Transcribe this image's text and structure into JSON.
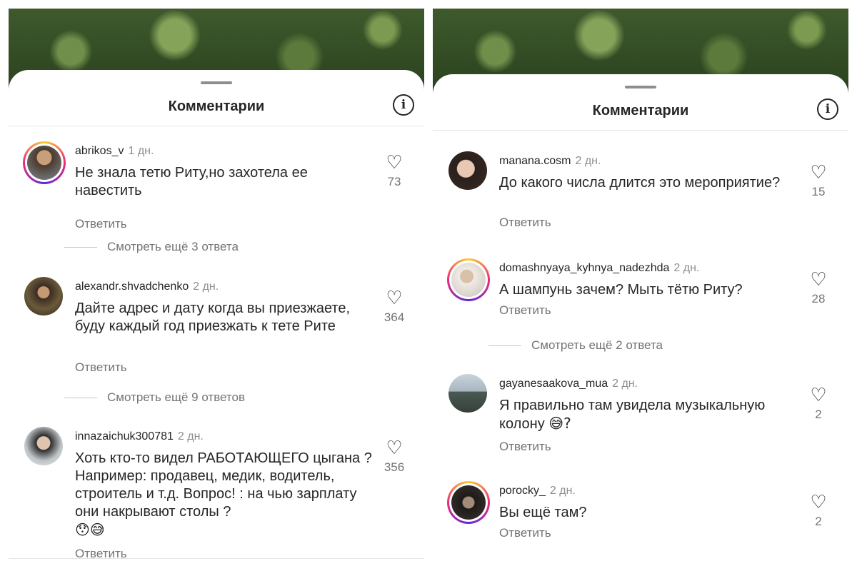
{
  "left_panel": {
    "title": "Комментарии",
    "comments": [
      {
        "username": "abrikos_v",
        "time": "1 дн.",
        "text": "Не знала тетю Риту,но захотела ее навестить",
        "likes": "73",
        "reply": "Ответить",
        "more": "Смотреть ещё 3 ответа"
      },
      {
        "username": "alexandr.shvadchenko",
        "time": "2 дн.",
        "text": "Дайте адрес и дату когда вы приезжаете, буду каждый год приезжать к тете Рите",
        "likes": "364",
        "reply": "Ответить",
        "more": "Смотреть ещё 9 ответов"
      },
      {
        "username": "innazaichuk300781",
        "time": "2 дн.",
        "text": "Хоть кто-то видел РАБОТАЮЩЕГО цыгана ?  Например: продавец, медик, водитель, строитель и т.д.  Вопрос! :  на чью зарплату они накрывают столы ?",
        "emoji": "😯😅",
        "likes": "356",
        "reply": "Ответить"
      }
    ]
  },
  "right_panel": {
    "title": "Комментарии",
    "comments": [
      {
        "username": "manana.cosm",
        "time": "2 дн.",
        "text": "До какого числа длится это мероприятие?",
        "likes": "15",
        "reply": "Ответить"
      },
      {
        "username": "domashnyaya_kyhnya_nadezhda",
        "time": "2 дн.",
        "text": "А шампунь зачем? Мыть тётю Риту?",
        "likes": "28",
        "reply": "Ответить",
        "more": "Смотреть ещё 2 ответа"
      },
      {
        "username": "gayanesaakova_mua",
        "time": "2 дн.",
        "text": "Я правильно там увидела музыкальную колону",
        "emoji_after": "😅?",
        "likes": "2",
        "reply": "Ответить"
      },
      {
        "username": "porocky_",
        "time": "2 дн.",
        "text": "Вы ещё там?",
        "likes": "2",
        "reply": "Ответить"
      }
    ]
  },
  "icons": {
    "info": "info-icon",
    "heart": "heart-outline-icon"
  },
  "colors": {
    "text": "#262626",
    "secondary": "#737373",
    "ring_start": "#f9ce34",
    "ring_mid": "#ee2a7b",
    "ring_end": "#6228d7"
  }
}
